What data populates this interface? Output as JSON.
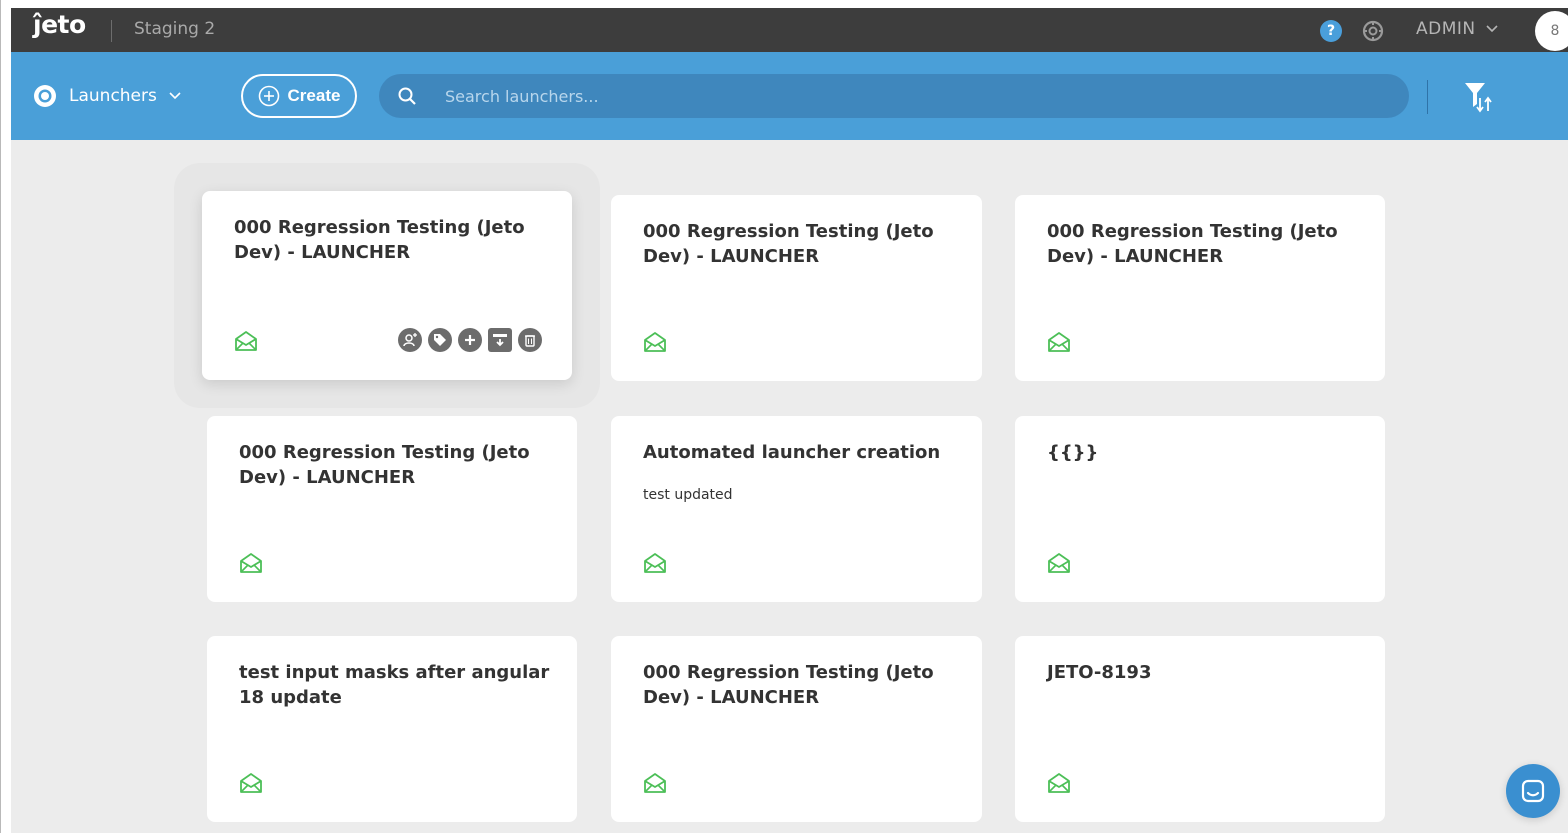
{
  "app": {
    "logo_text": "ĵeto",
    "environment": "Staging 2",
    "user_label": "ADMIN",
    "avatar_initial": "8"
  },
  "toolbar": {
    "section_label": "Launchers",
    "create_label": "Create",
    "search_placeholder": "Search launchers..."
  },
  "colors": {
    "topbar": "#3d3d3d",
    "toolbar": "#4a9fd8",
    "search_bg": "#3f87bd",
    "envelope_icon": "#4cbf57",
    "action_icon": "#6c6c6c"
  },
  "cards": [
    {
      "title": "000 Regression Testing (Jeto Dev) - LAUNCHER",
      "description": "",
      "icon": "envelope-open-icon"
    },
    {
      "title": "000 Regression Testing (Jeto Dev) - LAUNCHER",
      "description": "",
      "icon": "envelope-open-icon"
    },
    {
      "title": "000 Regression Testing (Jeto Dev) - LAUNCHER",
      "description": "",
      "icon": "envelope-open-icon"
    },
    {
      "title": "000 Regression Testing (Jeto Dev) - LAUNCHER",
      "description": "",
      "icon": "envelope-open-icon"
    },
    {
      "title": "Automated launcher creation",
      "description": "test updated",
      "icon": "envelope-open-icon"
    },
    {
      "title": "{{}}",
      "description": "",
      "icon": "envelope-open-icon"
    },
    {
      "title": "test input masks after angular 18 update",
      "description": "",
      "icon": "envelope-open-icon"
    },
    {
      "title": "000 Regression Testing (Jeto Dev) - LAUNCHER",
      "description": "",
      "icon": "envelope-open-icon"
    },
    {
      "title": "JETO-8193",
      "description": "",
      "icon": "envelope-open-icon"
    }
  ],
  "card_actions": [
    "add-user-icon",
    "tag-icon",
    "add-icon",
    "archive-icon",
    "delete-icon"
  ]
}
